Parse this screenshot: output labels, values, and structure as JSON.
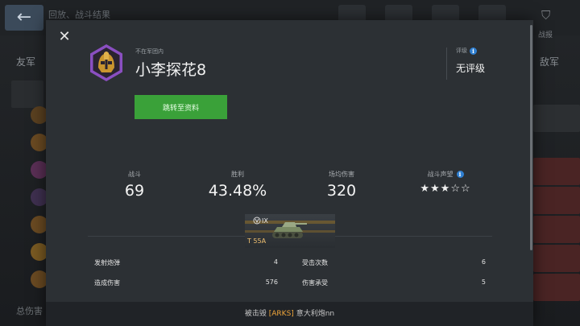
{
  "background": {
    "title": "回放、战斗结果",
    "left_team_label": "友军",
    "right_team_label": "敌军",
    "right_top_label": "战报",
    "bottom_left_label": "总伤害"
  },
  "dialog": {
    "clan_status": "不在军团内",
    "player_name": "小李探花8",
    "rating_label": "评级",
    "rating_value": "无评级",
    "profile_button": "跳转至资料",
    "stats": {
      "battles_label": "战斗",
      "battles_value": "69",
      "wins_label": "胜利",
      "wins_value": "43.48%",
      "avg_damage_label": "场均伤害",
      "avg_damage_value": "320",
      "prestige_label": "战斗声望",
      "prestige_stars": "★★★☆☆"
    },
    "tank": {
      "tier": "IX",
      "name": "T 55A"
    },
    "details": [
      {
        "label": "发射炮弹",
        "value": "4"
      },
      {
        "label": "受击次数",
        "value": "6"
      },
      {
        "label": "造成伤害",
        "value": "576"
      },
      {
        "label": "伤害承受",
        "value": "5"
      }
    ],
    "footer": {
      "prefix": "被击毁",
      "clan_tag": "[ARKS]",
      "killer": "意大利炮nn"
    }
  },
  "colors": {
    "accent_green": "#3aa139",
    "avatar_purple": "#8a4fc1",
    "clan_tag_orange": "#f0a63a",
    "info_blue": "#2f7fd1"
  }
}
